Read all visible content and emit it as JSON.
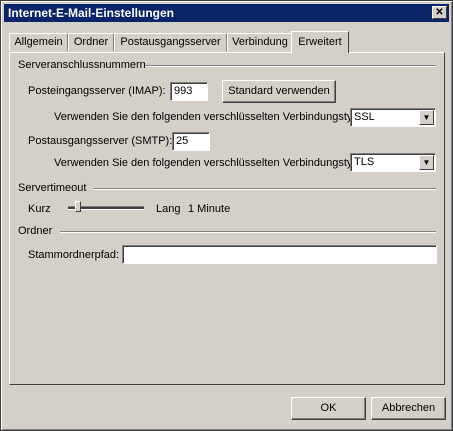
{
  "window": {
    "title": "Internet-E-Mail-Einstellungen"
  },
  "tabs": [
    {
      "label": "Allgemein"
    },
    {
      "label": "Ordner"
    },
    {
      "label": "Postausgangsserver"
    },
    {
      "label": "Verbindung"
    },
    {
      "label": "Erweitert"
    }
  ],
  "server_ports": {
    "group_label": "Serveranschlussnummern",
    "incoming_label": "Posteingangsserver (IMAP):",
    "incoming_value": "993",
    "default_button": "Standard verwenden",
    "incoming_enc_label": "Verwenden Sie den folgenden verschlüsselten Verbindungstyp:",
    "incoming_enc_value": "SSL",
    "outgoing_label": "Postausgangsserver (SMTP):",
    "outgoing_value": "25",
    "outgoing_enc_label": "Verwenden Sie den folgenden verschlüsselten Verbindungstyp:",
    "outgoing_enc_value": "TLS"
  },
  "timeout": {
    "group_label": "Servertimeout",
    "short_label": "Kurz",
    "long_label": "Lang",
    "value_text": "1 Minute",
    "slider_fraction": 0.1
  },
  "folders": {
    "group_label": "Ordner",
    "root_path_label": "Stammordnerpfad:",
    "root_path_value": ""
  },
  "buttons": {
    "ok": "OK",
    "cancel": "Abbrechen"
  }
}
